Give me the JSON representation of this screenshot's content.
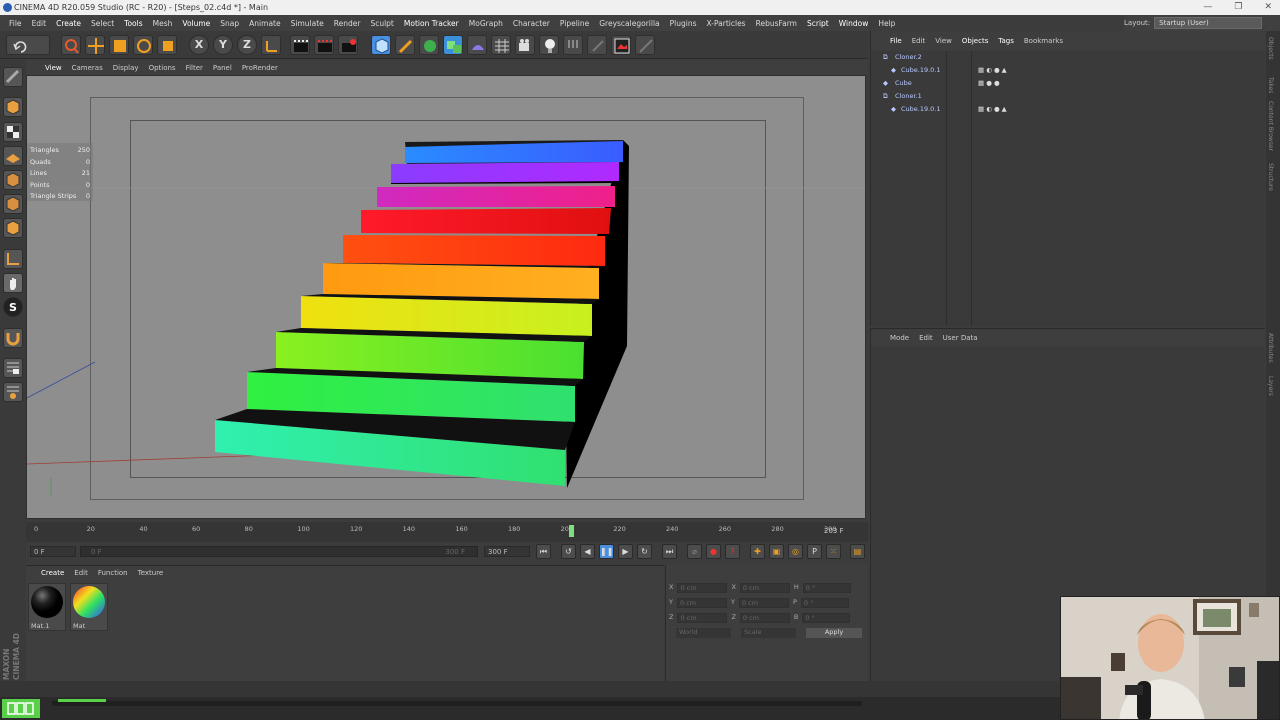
{
  "window": {
    "title": "CINEMA 4D R20.059 Studio (RC - R20) - [Steps_02.c4d *] - Main",
    "buttons": [
      "—",
      "❐",
      "✕"
    ]
  },
  "menubar": [
    "File",
    "Edit",
    "Create",
    "Select",
    "Tools",
    "Mesh",
    "Volume",
    "Snap",
    "Animate",
    "Simulate",
    "Render",
    "Sculpt",
    "Motion Tracker",
    "MoGraph",
    "Character",
    "Pipeline",
    "Greyscalegorilla",
    "Plugins",
    "X-Particles",
    "RebusFarm",
    "Script",
    "Window",
    "Help"
  ],
  "layout": {
    "label": "Layout:",
    "value": "Startup (User)"
  },
  "toolbar": {
    "x_label": "X",
    "y_label": "Y",
    "z_label": "Z"
  },
  "viewport_menu": [
    "View",
    "Cameras",
    "Display",
    "Options",
    "Filter",
    "Panel",
    "ProRender"
  ],
  "stats": [
    {
      "label": "Triangles",
      "value": "250"
    },
    {
      "label": "Quads",
      "value": "0"
    },
    {
      "label": "Lines",
      "value": "21"
    },
    {
      "label": "Points",
      "value": "0"
    },
    {
      "label": "Triangle Strips",
      "value": "0"
    }
  ],
  "timeline": {
    "ticks": [
      "0",
      "20",
      "40",
      "60",
      "80",
      "100",
      "120",
      "140",
      "160",
      "180",
      "200",
      "220",
      "240",
      "260",
      "280",
      "300"
    ],
    "current_frame": "203 F",
    "start_field": "0 F",
    "scrub_start": "0 F",
    "scrub_end": "300 F",
    "end_field": "300 F",
    "playhead_value": 203,
    "frame_max": 300
  },
  "material_menu": [
    "Create",
    "Edit",
    "Function",
    "Texture"
  ],
  "materials": [
    {
      "name": "Mat.1",
      "color": "#1a1a1a"
    },
    {
      "name": "Mat",
      "color": "rainbow"
    }
  ],
  "coords": {
    "rows": [
      {
        "a": "X",
        "av": "0 cm",
        "b": "X",
        "bv": "0 cm",
        "c": "H",
        "cv": "0 °"
      },
      {
        "a": "Y",
        "av": "0 cm",
        "b": "Y",
        "bv": "0 cm",
        "c": "P",
        "cv": "0 °"
      },
      {
        "a": "Z",
        "av": "0 cm",
        "b": "Z",
        "bv": "0 cm",
        "c": "B",
        "cv": "0 °"
      }
    ],
    "world": "World",
    "scale": "Scale",
    "apply": "Apply"
  },
  "object_menu": [
    "File",
    "Edit",
    "View",
    "Objects",
    "Tags",
    "Bookmarks"
  ],
  "objects": [
    {
      "name": "Cloner.2",
      "indent": 0
    },
    {
      "name": "Cube.19.0.1",
      "indent": 1
    },
    {
      "name": "Cube",
      "indent": 0
    },
    {
      "name": "Cloner.1",
      "indent": 0
    },
    {
      "name": "Cube.19.0.1",
      "indent": 1
    }
  ],
  "attribute_menu": [
    "Mode",
    "Edit",
    "User Data"
  ],
  "right_tabs": [
    "Objects",
    "Takes",
    "Content Browser",
    "Structure",
    "Attributes",
    "Layers"
  ],
  "branding": "MAXON CINEMA 4D",
  "colors": {
    "accent": "#4a90e2",
    "panel": "#3a3a3a",
    "viewport": "#8e8e8e"
  }
}
